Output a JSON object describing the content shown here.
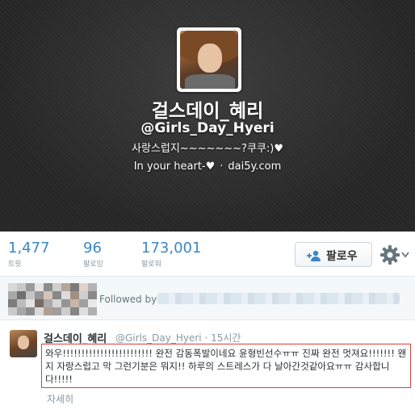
{
  "profile": {
    "name": "걸스데이_혜리",
    "handle": "@Girls_Day_Hyeri",
    "bio": "사랑스럽지~~~~~~~?쿠쿠:)♥",
    "location": "In your heart-♥",
    "separator": "·",
    "website": "dai5y.com"
  },
  "stats": [
    {
      "value": "1,477",
      "label": "트윗"
    },
    {
      "value": "96",
      "label": "팔로잉"
    },
    {
      "value": "173,001",
      "label": "팔로워"
    }
  ],
  "actions": {
    "follow_label": "팔로우"
  },
  "followed_by": {
    "label": "Followed by"
  },
  "tweet": {
    "author_name": "걸스데이_혜리",
    "author_handle": "@Girls_Day_Hyeri",
    "time": "15시간",
    "time_separator": "·",
    "text": "와우!!!!!!!!!!!!!!!!!!!!!!!! 완전 감동폭발이네요 윤형빈선수ㅠㅠ 진짜 완전 멋져요!!!!!!! 왠지 자랑스럽고 막 그런기분은 뭐지!! 하루의 스트레스가 다 날아간것같아요ㅠㅠ 감사합니다!!!!!",
    "expand_label": "자세히"
  },
  "colors": {
    "accent": "#3a87c6",
    "highlight_border": "#e23b3b"
  }
}
